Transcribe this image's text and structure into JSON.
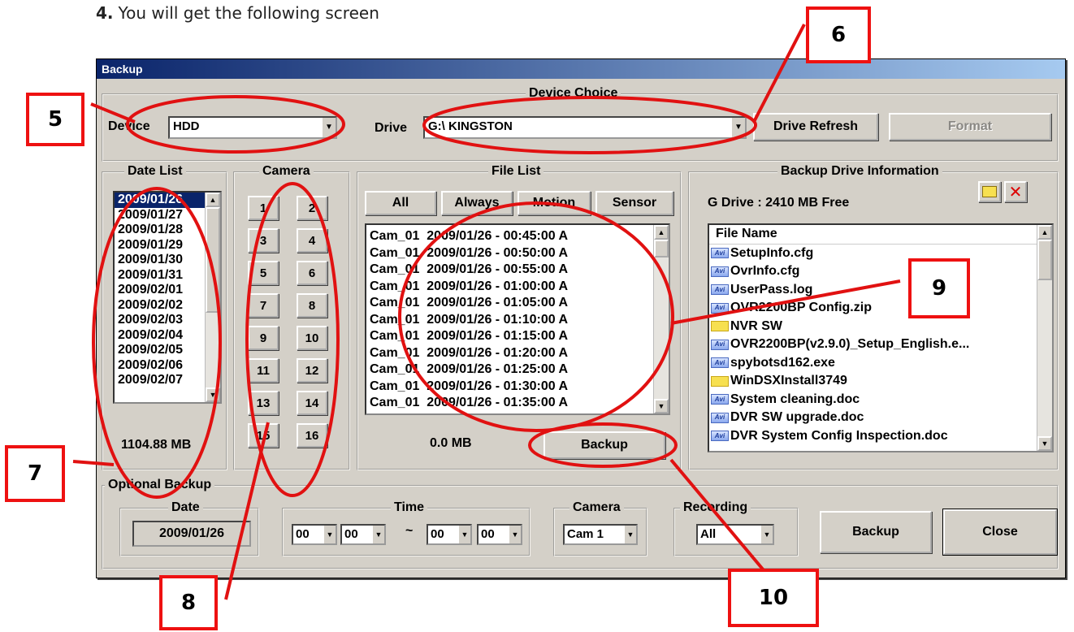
{
  "doc": {
    "step_number": "4.",
    "step_text": "You will get the following screen"
  },
  "window": {
    "title": "Backup"
  },
  "device_choice": {
    "group_title": "Device Choice",
    "device_label": "Device",
    "device_value": "HDD",
    "drive_label": "Drive",
    "drive_value": "G:\\ KINGSTON",
    "drive_refresh_label": "Drive Refresh",
    "format_label": "Format"
  },
  "date_list": {
    "group_title": "Date List",
    "dates": [
      "2009/01/26",
      "2009/01/27",
      "2009/01/28",
      "2009/01/29",
      "2009/01/30",
      "2009/01/31",
      "2009/02/01",
      "2009/02/02",
      "2009/02/03",
      "2009/02/04",
      "2009/02/05",
      "2009/02/06",
      "2009/02/07"
    ],
    "size": "1104.88 MB"
  },
  "camera": {
    "group_title": "Camera",
    "buttons": [
      "1",
      "2",
      "3",
      "4",
      "5",
      "6",
      "7",
      "8",
      "9",
      "10",
      "11",
      "12",
      "13",
      "14",
      "15",
      "16"
    ]
  },
  "file_list": {
    "group_title": "File List",
    "filters": [
      "All",
      "Always",
      "Motion",
      "Sensor"
    ],
    "files": [
      "Cam_01  2009/01/26 - 00:45:00 A",
      "Cam_01  2009/01/26 - 00:50:00 A",
      "Cam_01  2009/01/26 - 00:55:00 A",
      "Cam_01  2009/01/26 - 01:00:00 A",
      "Cam_01  2009/01/26 - 01:05:00 A",
      "Cam_01  2009/01/26 - 01:10:00 A",
      "Cam_01  2009/01/26 - 01:15:00 A",
      "Cam_01  2009/01/26 - 01:20:00 A",
      "Cam_01  2009/01/26 - 01:25:00 A",
      "Cam_01  2009/01/26 - 01:30:00 A",
      "Cam_01  2009/01/26 - 01:35:00 A"
    ],
    "size": "0.0 MB",
    "backup_label": "Backup"
  },
  "backup_drive": {
    "group_title": "Backup Drive Information",
    "free_text": "G Drive : 2410 MB  Free",
    "header": "File Name",
    "files": [
      {
        "name": "SetupInfo.cfg",
        "icon": "avi-file-icon"
      },
      {
        "name": "OvrInfo.cfg",
        "icon": "avi-file-icon"
      },
      {
        "name": "UserPass.log",
        "icon": "avi-file-icon"
      },
      {
        "name": "OVR2200BP Config.zip",
        "icon": "avi-file-icon"
      },
      {
        "name": "NVR SW",
        "icon": "folder-icon"
      },
      {
        "name": "OVR2200BP(v2.9.0)_Setup_English.e...",
        "icon": "avi-file-icon"
      },
      {
        "name": "spybotsd162.exe",
        "icon": "avi-file-icon"
      },
      {
        "name": "WinDSXInstall3749",
        "icon": "folder-icon"
      },
      {
        "name": "System cleaning.doc",
        "icon": "avi-file-icon"
      },
      {
        "name": "DVR SW upgrade.doc",
        "icon": "avi-file-icon"
      },
      {
        "name": "DVR System Config Inspection.doc",
        "icon": "avi-file-icon"
      }
    ]
  },
  "optional_backup": {
    "group_title": "Optional Backup",
    "date_title": "Date",
    "date_value": "2009/01/26",
    "time_title": "Time",
    "time_from_h": "00",
    "time_from_m": "00",
    "time_sep": "~",
    "time_to_h": "00",
    "time_to_m": "00",
    "camera_title": "Camera",
    "camera_value": "Cam 1",
    "recording_title": "Recording",
    "recording_value": "All",
    "backup_label": "Backup",
    "close_label": "Close"
  },
  "annotations": [
    "5",
    "6",
    "7",
    "8",
    "9",
    "10"
  ],
  "colors": {
    "annotation": "#e11111",
    "selection": "#0a246a",
    "dialog_bg": "#d4d0c8"
  }
}
